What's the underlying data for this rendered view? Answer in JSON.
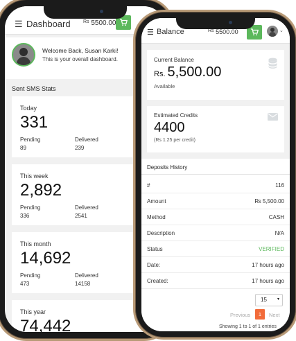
{
  "dashboard": {
    "title": "Dashboard",
    "balance_prefix": "Rs",
    "balance_value": "5500.00",
    "welcome": "Welcome Back, Susan Karki!",
    "welcome_sub": "This is your overall dashboard.",
    "section_title": "Sent SMS Stats",
    "pending_label": "Pending",
    "delivered_label": "Delivered",
    "stats": [
      {
        "period": "Today",
        "total": "331",
        "pending": "89",
        "delivered": "239"
      },
      {
        "period": "This week",
        "total": "2,892",
        "pending": "336",
        "delivered": "2541"
      },
      {
        "period": "This month",
        "total": "14,692",
        "pending": "473",
        "delivered": "14158"
      },
      {
        "period": "This year",
        "total": "74,442"
      }
    ]
  },
  "balance_screen": {
    "title": "Balance",
    "balance_prefix": "Rs",
    "balance_value": "5500.00",
    "current_balance_label": "Current Balance",
    "current_balance_prefix": "Rs.",
    "current_balance_value": "5,500.00",
    "available_label": "Available",
    "credits_label": "Estimated Credits",
    "credits_value": "4400",
    "credits_note": "(Rs 1.25 per credit)",
    "deposits_title": "Deposits History",
    "deposit_rows": [
      {
        "key": "#",
        "value": "116"
      },
      {
        "key": "Amount",
        "value": "₨ 5,500.00"
      },
      {
        "key": "Method",
        "value": "CASH"
      },
      {
        "key": "Description",
        "value": "N/A"
      },
      {
        "key": "Status",
        "value": "VERIFIED"
      },
      {
        "key": "Date:",
        "value": "17 hours ago"
      },
      {
        "key": "Created:",
        "value": "17 hours ago"
      }
    ],
    "page_size": "15",
    "prev_label": "Previous",
    "current_page": "1",
    "next_label": "Next",
    "showing_text": "Showing 1 to 1 of 1 entries"
  },
  "icons": {
    "menu": "menu-icon",
    "cart": "cart-icon",
    "database": "database-icon",
    "envelope": "envelope-icon",
    "avatar": "avatar",
    "chevron": "chevron-down-icon"
  },
  "colors": {
    "accent_green": "#5cb85c",
    "pagination_active": "#f26b3a",
    "phone_frame": "#b89a77"
  }
}
